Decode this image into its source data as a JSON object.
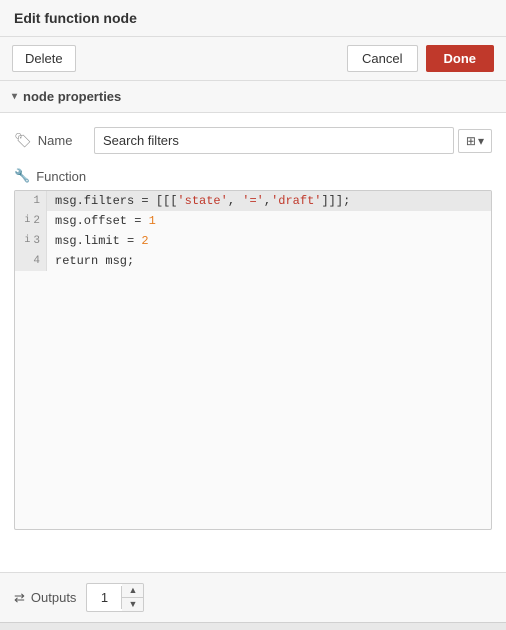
{
  "header": {
    "title": "Edit function node"
  },
  "toolbar": {
    "delete_label": "Delete",
    "cancel_label": "Cancel",
    "done_label": "Done"
  },
  "section": {
    "label": "node properties",
    "chevron": "▾"
  },
  "name_field": {
    "label": "Name",
    "icon": "🏷",
    "value": "Search filters",
    "placeholder": "Search filters",
    "btn_icon": "⊞",
    "btn_arrow": "▾"
  },
  "function_field": {
    "label": "Function",
    "icon": "🔧"
  },
  "code": {
    "lines": [
      {
        "num": "1",
        "indicator": "",
        "highlighted": true,
        "content": "msg.filters = [[['state', '=','draft']]];"
      },
      {
        "num": "2",
        "indicator": "i",
        "highlighted": false,
        "content": "msg.offset = 1"
      },
      {
        "num": "3",
        "indicator": "i",
        "highlighted": false,
        "content": "msg.limit = 2"
      },
      {
        "num": "4",
        "indicator": "",
        "highlighted": false,
        "content": "return msg;"
      }
    ]
  },
  "outputs": {
    "label": "Outputs",
    "icon": "⇄",
    "value": "1",
    "up_btn": "▲",
    "down_btn": "▼"
  }
}
